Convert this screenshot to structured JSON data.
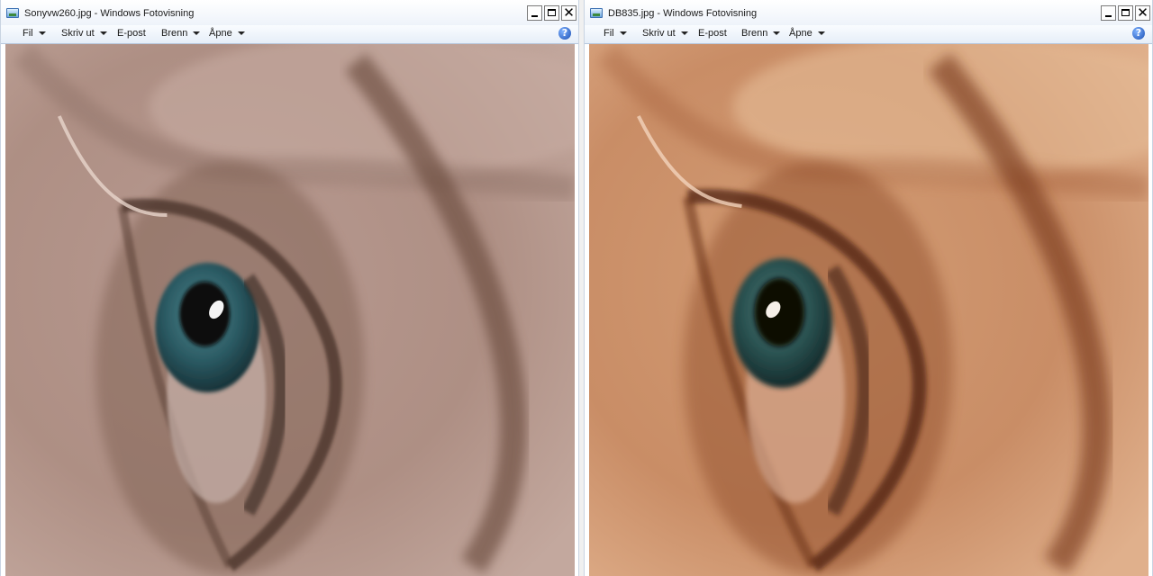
{
  "windows": [
    {
      "title": "Sonyvw260.jpg - Windows Fotovisning",
      "menu": {
        "file": "Fil",
        "print": "Skriv ut",
        "email": "E-post",
        "burn": "Brenn",
        "open": "Åpne"
      }
    },
    {
      "title": "DB835.jpg - Windows Fotovisning",
      "menu": {
        "file": "Fil",
        "print": "Skriv ut",
        "email": "E-post",
        "burn": "Brenn",
        "open": "Åpne"
      }
    }
  ],
  "help_glyph": "?",
  "close_glyph": "✕",
  "colors": {
    "left_skin": "#b5978c",
    "right_skin": "#d19a72",
    "iris": "#2d5c66"
  }
}
